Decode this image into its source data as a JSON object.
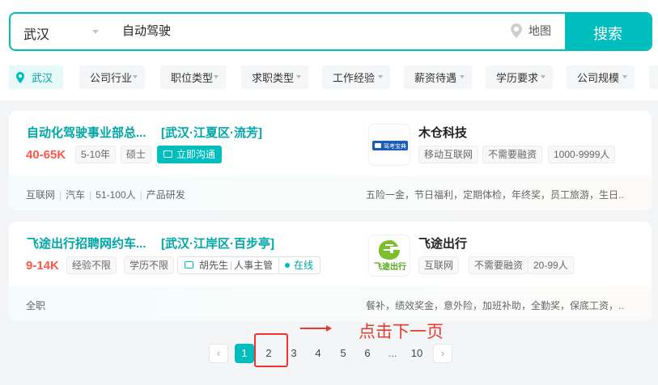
{
  "search": {
    "city": "武汉",
    "query": "自动驾驶",
    "map_label": "地图",
    "button_label": "搜索"
  },
  "filters": {
    "city_chip": "武汉",
    "items": [
      "公司行业",
      "职位类型",
      "求职类型",
      "工作经验",
      "薪资待遇",
      "学历要求",
      "公司规模"
    ]
  },
  "jobs": [
    {
      "title": "自动化驾驶事业部总...",
      "area": "[武汉·江夏区·流芳]",
      "salary": "40-65K",
      "tags": [
        "5-10年",
        "硕士"
      ],
      "chat_label": "立即沟通",
      "company": "木仓科技",
      "logo_text": "驾考宝典",
      "company_tags": [
        "移动互联网",
        "不需要融资",
        "1000-9999人"
      ],
      "bottom_tags": [
        "互联网",
        "汽车",
        "51-100人",
        "产品研发"
      ],
      "welfare": "五险一金，节日福利，定期体检，年终奖，员工旅游，生日..."
    },
    {
      "title": "飞途出行招聘网约车...",
      "area": "[武汉·江岸区·百步亭]",
      "salary": "9-14K",
      "tags": [
        "经验不限",
        "学历不限"
      ],
      "boss_name": "胡先生",
      "boss_title": "人事主管",
      "online_label": "在线",
      "company": "飞途出行",
      "logo_text": "飞途出行",
      "company_tags": [
        "互联网",
        "不需要融资",
        "20-99人"
      ],
      "bottom_tags": [
        "全职"
      ],
      "welfare": "餐补，绩效奖金，意外险，加班补助，全勤奖，保底工资，..."
    }
  ],
  "pagination": {
    "prev": "‹",
    "next": "›",
    "pages": [
      "1",
      "2",
      "3",
      "4",
      "5",
      "6"
    ],
    "ellipsis": "...",
    "last": "10",
    "current": "1"
  },
  "annotation": {
    "hint": "点击下一页"
  },
  "colors": {
    "accent": "#00bebd",
    "salary": "#fe574a",
    "annotation": "#e63b2e"
  }
}
